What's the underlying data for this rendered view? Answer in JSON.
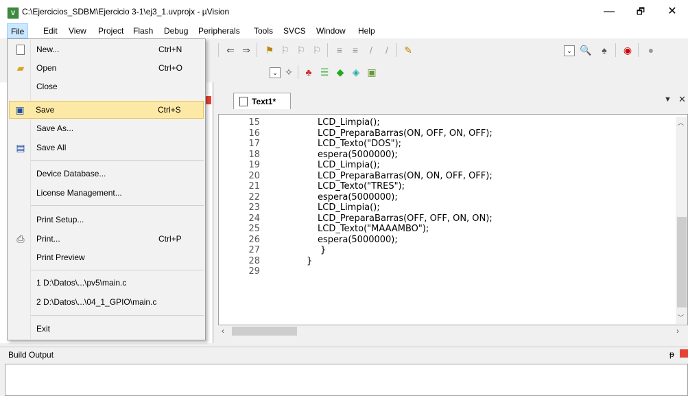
{
  "window": {
    "title": "C:\\Ejercicios_SDBM\\Ejercicio 3-1\\ej3_1.uvprojx - µVision",
    "app_icon_glyph": "V",
    "minimize_glyph": "—",
    "maximize_glyph": "🗗",
    "close_glyph": "✕"
  },
  "menubar": {
    "items": [
      "File",
      "Edit",
      "View",
      "Project",
      "Flash",
      "Debug",
      "Peripherals",
      "Tools",
      "SVCS",
      "Window",
      "Help"
    ]
  },
  "file_menu": {
    "items": [
      {
        "label": "New...",
        "shortcut": "Ctrl+N",
        "icon": "new-file-icon"
      },
      {
        "label": "Open",
        "shortcut": "Ctrl+O",
        "icon": "open-folder-icon"
      },
      {
        "label": "Close",
        "shortcut": "",
        "icon": ""
      },
      {
        "label": "Save",
        "shortcut": "Ctrl+S",
        "icon": "save-disk-icon",
        "highlighted": true
      },
      {
        "label": "Save As...",
        "shortcut": "",
        "icon": ""
      },
      {
        "label": "Save All",
        "shortcut": "",
        "icon": "save-all-icon"
      },
      {
        "label": "Device Database...",
        "shortcut": "",
        "icon": ""
      },
      {
        "label": "License Management...",
        "shortcut": "",
        "icon": ""
      },
      {
        "label": "Print Setup...",
        "shortcut": "",
        "icon": ""
      },
      {
        "label": "Print...",
        "shortcut": "Ctrl+P",
        "icon": "printer-icon"
      },
      {
        "label": "Print Preview",
        "shortcut": "",
        "icon": ""
      },
      {
        "label": "1 D:\\Datos\\...\\pv5\\main.c",
        "shortcut": "",
        "icon": ""
      },
      {
        "label": "2 D:\\Datos\\...\\04_1_GPIO\\main.c",
        "shortcut": "",
        "icon": ""
      },
      {
        "label": "Exit",
        "shortcut": "",
        "icon": ""
      }
    ]
  },
  "editor": {
    "tab_label": "Text1*",
    "lines": [
      {
        "num": "15",
        "code": "LCD_Limpia();"
      },
      {
        "num": "16",
        "code": "LCD_PreparaBarras(ON, OFF, ON, OFF);"
      },
      {
        "num": "17",
        "code": "LCD_Texto(\"DOS\");"
      },
      {
        "num": "18",
        "code": "espera(5000000);"
      },
      {
        "num": "19",
        "code": "LCD_Limpia();"
      },
      {
        "num": "20",
        "code": "LCD_PreparaBarras(ON, ON, OFF, OFF);"
      },
      {
        "num": "21",
        "code": "LCD_Texto(\"TRES\");"
      },
      {
        "num": "22",
        "code": "espera(5000000);"
      },
      {
        "num": "23",
        "code": "LCD_Limpia();"
      },
      {
        "num": "24",
        "code": "LCD_PreparaBarras(OFF, OFF, ON, ON);"
      },
      {
        "num": "25",
        "code": "LCD_Texto(\"MAAAMBO\");"
      },
      {
        "num": "26",
        "code": "espera(5000000);"
      },
      {
        "num": "27",
        "code": "}"
      },
      {
        "num": "28",
        "code": "}"
      },
      {
        "num": "29",
        "code": ""
      }
    ]
  },
  "build_output": {
    "title": "Build Output"
  },
  "colors": {
    "menu_highlight": "#fde9a6",
    "menubar_active": "#cce8ff",
    "close_red": "#e34234"
  }
}
